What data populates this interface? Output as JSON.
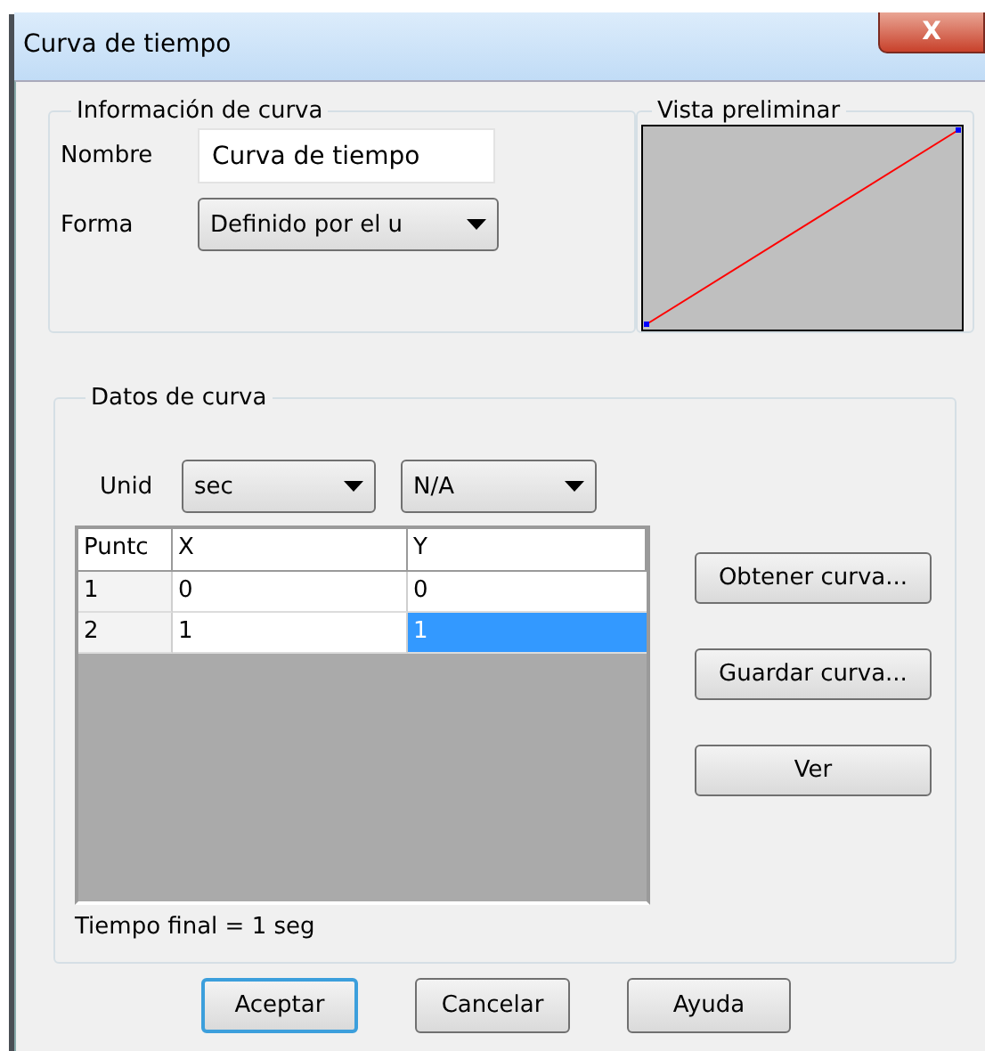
{
  "window": {
    "title": "Curva de tiempo",
    "close": "X"
  },
  "curve_info": {
    "legend": "Información de curva",
    "name_label": "Nombre",
    "name_value": "Curva de tiempo",
    "shape_label": "Forma",
    "shape_value": "Definido por el u"
  },
  "preview": {
    "legend": "Vista preliminar"
  },
  "curve_data": {
    "legend": "Datos de curva",
    "unit_label": "Unid",
    "unit_x": "sec",
    "unit_y": "N/A",
    "table": {
      "columns": [
        "Puntc",
        "X",
        "Y"
      ],
      "rows": [
        [
          {
            "text": "1",
            "selected": false
          },
          {
            "text": "0",
            "selected": false
          },
          {
            "text": "0",
            "selected": false
          }
        ],
        [
          {
            "text": "2",
            "selected": false
          },
          {
            "text": "1",
            "selected": false
          },
          {
            "text": "1",
            "selected": true
          }
        ]
      ]
    },
    "side_buttons": [
      "Obtener curva...",
      "Guardar curva...",
      "Ver"
    ],
    "status": "Tiempo final = 1 seg"
  },
  "buttons": [
    {
      "label": "Aceptar",
      "default": true
    },
    {
      "label": "Cancelar",
      "default": false
    },
    {
      "label": "Ayuda",
      "default": false
    }
  ]
}
